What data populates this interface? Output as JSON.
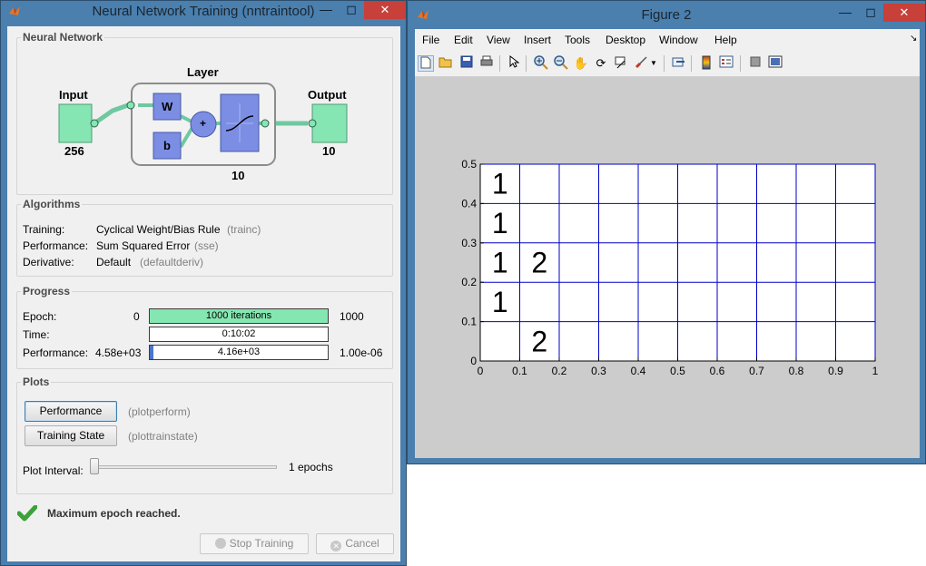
{
  "train_window": {
    "title": "Neural Network Training (nntraintool)",
    "sections": {
      "network": "Neural Network",
      "algorithms": "Algorithms",
      "progress": "Progress",
      "plots": "Plots"
    },
    "diagram": {
      "input_label": "Input",
      "input_size": "256",
      "layer_label": "Layer",
      "w_label": "W",
      "b_label": "b",
      "plus_label": "+",
      "layer_size": "10",
      "output_label": "Output",
      "output_size": "10"
    },
    "algorithms": [
      {
        "label": "Training:",
        "value": "Cyclical Weight/Bias Rule",
        "code": "(trainc)"
      },
      {
        "label": "Performance:",
        "value": "Sum Squared Error",
        "code": "(sse)"
      },
      {
        "label": "Derivative:",
        "value": "Default",
        "code": "(defaultderiv)"
      }
    ],
    "progress": {
      "epoch": {
        "label": "Epoch:",
        "start": "0",
        "text": "1000 iterations",
        "end": "1000",
        "fraction": 1.0
      },
      "time": {
        "label": "Time:",
        "text": "0:10:02"
      },
      "performance": {
        "label": "Performance:",
        "start": "4.58e+03",
        "text": "4.16e+03",
        "end": "1.00e-06",
        "fraction": 0.02
      }
    },
    "plots": {
      "performance_button": "Performance",
      "performance_fn": "(plotperform)",
      "trainstate_button": "Training State",
      "trainstate_fn": "(plottrainstate)",
      "interval_label": "Plot Interval:",
      "interval_value": "1 epochs",
      "interval_fraction": 0.0
    },
    "status": "Maximum epoch reached.",
    "stop_button": "Stop Training",
    "cancel_button": "Cancel"
  },
  "figure_window": {
    "title": "Figure 2",
    "menu": [
      "File",
      "Edit",
      "View",
      "Insert",
      "Tools",
      "Desktop",
      "Window",
      "Help"
    ],
    "toolbar_icons": [
      "new-figure-icon",
      "open-icon",
      "save-icon",
      "print-icon",
      "pointer-icon",
      "zoom-in-icon",
      "zoom-out-icon",
      "pan-icon",
      "rotate-icon",
      "data-cursor-icon",
      "brush-icon",
      "link-icon",
      "colorbar-icon",
      "legend-icon",
      "hide-plot-tools-icon",
      "show-plot-tools-icon"
    ]
  },
  "chart_data": {
    "type": "table",
    "title": "",
    "xlabel": "",
    "ylabel": "",
    "xlim": [
      0,
      1
    ],
    "ylim": [
      0,
      0.5
    ],
    "xticks": [
      "0",
      "0.1",
      "0.2",
      "0.3",
      "0.4",
      "0.5",
      "0.6",
      "0.7",
      "0.8",
      "0.9",
      "1"
    ],
    "yticks": [
      "0",
      "0.1",
      "0.2",
      "0.3",
      "0.4",
      "0.5"
    ],
    "grid": true,
    "grid_color": "#0000c8",
    "cells": [
      {
        "x": 0.05,
        "y": 0.45,
        "text": "1"
      },
      {
        "x": 0.05,
        "y": 0.35,
        "text": "1"
      },
      {
        "x": 0.05,
        "y": 0.25,
        "text": "1"
      },
      {
        "x": 0.15,
        "y": 0.25,
        "text": "2"
      },
      {
        "x": 0.05,
        "y": 0.15,
        "text": "1"
      },
      {
        "x": 0.15,
        "y": 0.05,
        "text": "2"
      }
    ]
  }
}
